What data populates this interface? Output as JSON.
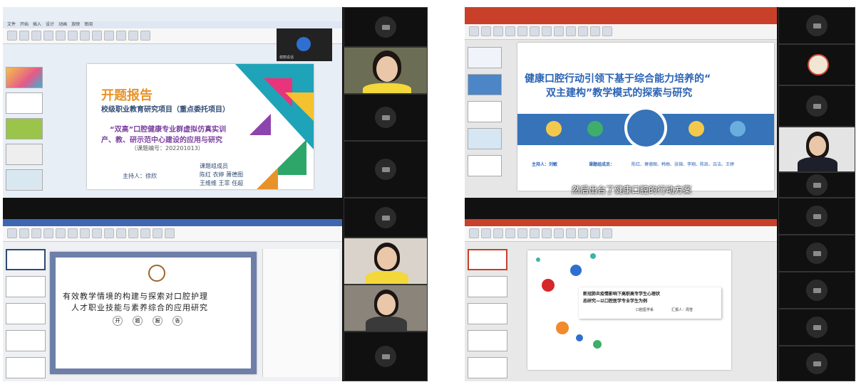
{
  "q1": {
    "label": "谢丽说话",
    "slide_title": "开题报告",
    "line1": "校级职业教育研究项目（重点委托项目）",
    "line2": "“双高”口腔健康专业群虚拟仿真实训",
    "line3": "产、教、研示范中心建设的应用与研究",
    "code": "（课题编号：202201013）",
    "members_title": "课题组成员",
    "host": "主持人：徐欣",
    "members_row1": "陈红  衣婷  萧德图",
    "members_row2": "王维维  王菲  任超"
  },
  "q2": {
    "title_line1": "健康口腔行动引领下基于综合能力培养的“",
    "title_line2": "双主建构”教学模式的探索与研究",
    "host_label": "主持人：刘敏",
    "members_label": "课题组成员：",
    "members": "陈红、萧德图、韩梅、张锦、李翔、陈凯、吕洁、王婷",
    "subtitle": "然后出台了健康口腔的行动方案"
  },
  "q3": {
    "title_line1": "有效教学情境的构建与探索对口腔护理",
    "title_line2": "人才职业技能与素养综合的应用研究",
    "chars": [
      "开",
      "题",
      "报",
      "告"
    ]
  },
  "q4": {
    "title_line1": "新冠肺炎疫情影响下高职高专学生心理状",
    "title_line2": "态研究—以口腔医学专业学生为例",
    "dept": "口腔医学系",
    "reporter": "汇报人：周雪"
  },
  "colors": {
    "orange": "#e8932a",
    "purple": "#7b3fa0",
    "blue": "#2b63b5",
    "navy": "#2e4a72",
    "pink": "#d4435c"
  }
}
